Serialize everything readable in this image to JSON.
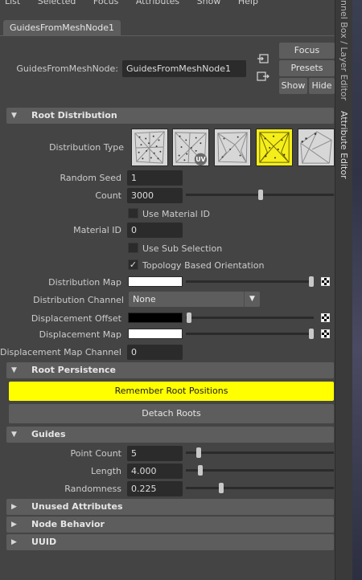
{
  "menubar": [
    "List",
    "Selected",
    "Focus",
    "Attributes",
    "Show",
    "Help"
  ],
  "side_tabs": {
    "channel_box": "nnel Box / Layer Editor",
    "attribute_editor": "Attribute Editor"
  },
  "tab": {
    "label": "GuidesFromMeshNode1"
  },
  "node": {
    "label": "GuidesFromMeshNode:",
    "value": "GuidesFromMeshNode1"
  },
  "buttons": {
    "focus": "Focus",
    "presets": "Presets",
    "show": "Show",
    "hide": "Hide"
  },
  "sections": {
    "root_distribution": "Root Distribution",
    "root_persistence": "Root Persistence",
    "guides": "Guides",
    "unused": "Unused Attributes",
    "node_behavior": "Node Behavior",
    "uuid": "UUID"
  },
  "distribution": {
    "label": "Distribution Type",
    "uv_badge": "UV",
    "selected_index": 3,
    "selected_color": "#f5ee1a"
  },
  "random_seed": {
    "label": "Random Seed",
    "value": "1"
  },
  "count": {
    "label": "Count",
    "value": "3000",
    "slider": 0.5
  },
  "use_material_id": {
    "label": "Use Material ID",
    "checked": false
  },
  "material_id": {
    "label": "Material ID",
    "value": "0"
  },
  "use_sub_selection": {
    "label": "Use Sub Selection",
    "checked": false
  },
  "topology": {
    "label": "Topology Based Orientation",
    "checked": true,
    "check_glyph": "✓"
  },
  "distribution_map": {
    "label": "Distribution Map",
    "color": "#ffffff",
    "slider": 1.0
  },
  "distribution_channel": {
    "label": "Distribution Channel",
    "value": "None"
  },
  "displacement_offset": {
    "label": "Displacement Offset",
    "color": "#000000",
    "slider": 0.0
  },
  "displacement_map": {
    "label": "Displacement Map",
    "color": "#ffffff",
    "slider": 1.0
  },
  "displacement_channel": {
    "label": "Displacement Map Channel",
    "value": "0"
  },
  "remember_button": {
    "label": "Remember Root Positions",
    "color": "#ffff00"
  },
  "detach_button": {
    "label": "Detach Roots"
  },
  "point_count": {
    "label": "Point Count",
    "value": "5",
    "slider": 0.08
  },
  "length": {
    "label": "Length",
    "value": "4.000",
    "slider": 0.1
  },
  "randomness": {
    "label": "Randomness",
    "value": "0.225",
    "slider": 0.24
  }
}
